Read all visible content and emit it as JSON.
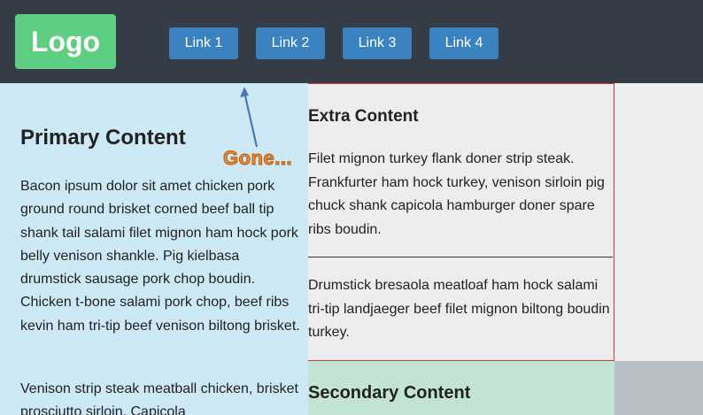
{
  "header": {
    "logo": "Logo",
    "links": [
      "Link 1",
      "Link 2",
      "Link 3",
      "Link 4"
    ]
  },
  "primary": {
    "title": "Primary Content",
    "paragraphs": [
      "Bacon ipsum dolor sit amet chicken pork ground round brisket corned beef ball tip shank tail salami filet mignon ham hock pork belly venison shankle. Pig kielbasa drumstick sausage pork chop boudin. Chicken t-bone salami pork chop, beef ribs kevin ham tri-tip beef venison biltong brisket.",
      "Venison strip steak meatball chicken, brisket prosciutto sirloin. Capicola"
    ]
  },
  "extra": {
    "title": "Extra Content",
    "paragraphs": [
      "Filet mignon turkey flank doner strip steak. Frankfurter ham hock turkey, venison sirloin pig chuck shank capicola hamburger doner spare ribs boudin.",
      "Drumstick bresaola meatloaf ham hock salami tri-tip landjaeger beef filet mignon biltong boudin turkey."
    ]
  },
  "secondary": {
    "title": "Secondary Content"
  },
  "annotation": {
    "text": "Gone..."
  },
  "colors": {
    "header_bg": "#353c45",
    "logo_bg": "#5ecf82",
    "link_bg": "#3b83c0",
    "primary_bg": "#cce9f5",
    "extra_bg": "#ecedef",
    "extra_border": "#d23b3b",
    "secondary_bg": "#c3e3d3",
    "annotation": "#f08a2b"
  }
}
